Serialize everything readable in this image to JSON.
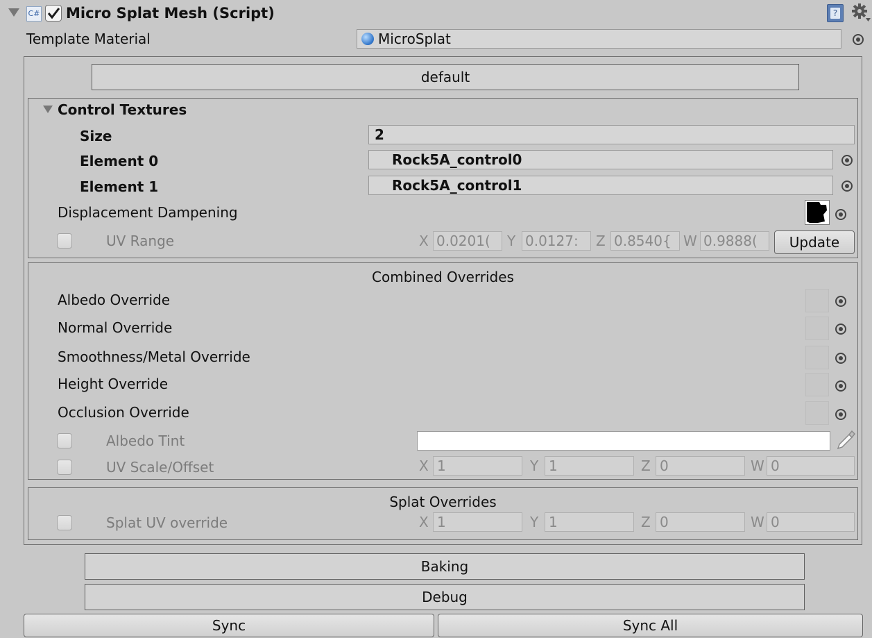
{
  "header": {
    "title": "Micro Splat Mesh (Script)",
    "script_icon_text": "C#",
    "enabled": true
  },
  "template_material": {
    "label": "Template Material",
    "value": "MicroSplat"
  },
  "profile_button": "default",
  "control_textures": {
    "label": "Control Textures",
    "size_label": "Size",
    "size_value": "2",
    "elements": [
      {
        "label": "Element 0",
        "value": "Rock5A_control0"
      },
      {
        "label": "Element 1",
        "value": "Rock5A_control1"
      }
    ],
    "displacement_label": "Displacement Dampening",
    "uv_range": {
      "label": "UV Range",
      "x_label": "X",
      "x_value": "0.0201(",
      "y_label": "Y",
      "y_value": "0.0127:",
      "z_label": "Z",
      "z_value": "0.8540{",
      "w_label": "W",
      "w_value": "0.9888(",
      "update_label": "Update"
    }
  },
  "combined_overrides": {
    "title": "Combined Overrides",
    "items": [
      "Albedo Override",
      "Normal Override",
      "Smoothness/Metal Override",
      "Height Override",
      "Occlusion Override"
    ],
    "albedo_tint_label": "Albedo Tint",
    "uv_scale": {
      "label": "UV Scale/Offset",
      "x_label": "X",
      "x_value": "1",
      "y_label": "Y",
      "y_value": "1",
      "z_label": "Z",
      "z_value": "0",
      "w_label": "W",
      "w_value": "0"
    }
  },
  "splat_overrides": {
    "title": "Splat Overrides",
    "uv": {
      "label": "Splat UV override",
      "x_label": "X",
      "x_value": "1",
      "y_label": "Y",
      "y_value": "1",
      "z_label": "Z",
      "z_value": "0",
      "w_label": "W",
      "w_value": "0"
    }
  },
  "buttons": {
    "baking": "Baking",
    "debug": "Debug",
    "sync": "Sync",
    "sync_all": "Sync All"
  }
}
